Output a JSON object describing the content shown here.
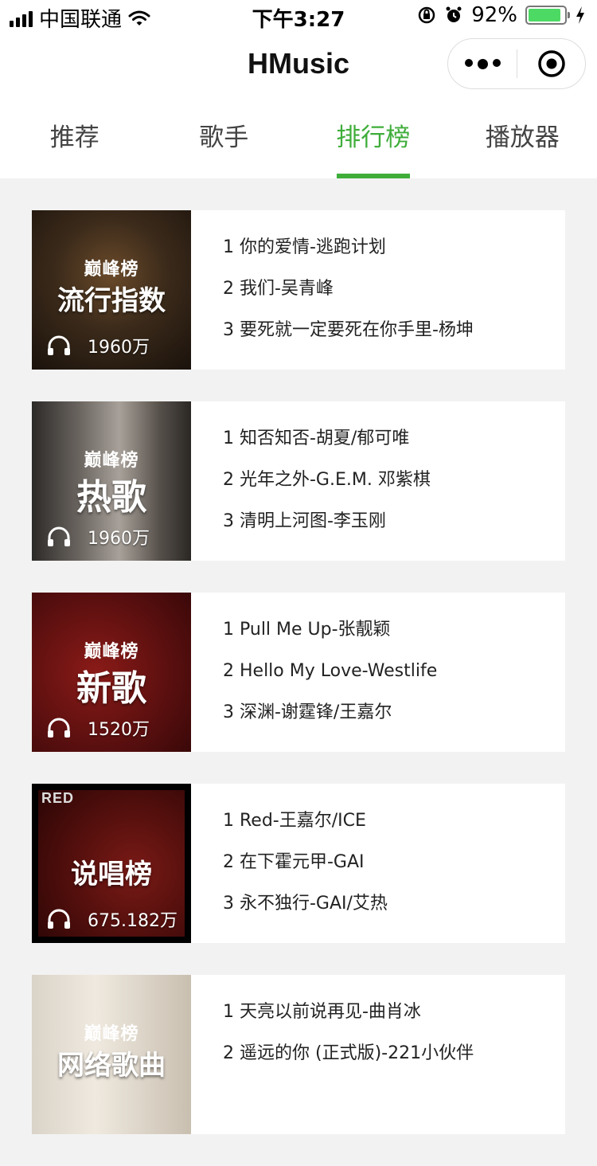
{
  "status_bar": {
    "carrier": "中国联通",
    "time": "下午3:27",
    "battery": "92%",
    "battery_level": 0.92
  },
  "nav": {
    "title": "HMusic"
  },
  "tabs": [
    {
      "label": "推荐",
      "active": false
    },
    {
      "label": "歌手",
      "active": false
    },
    {
      "label": "排行榜",
      "active": true
    },
    {
      "label": "播放器",
      "active": false
    }
  ],
  "accent_color": "#3fad3a",
  "charts": [
    {
      "brand": "巅峰榜",
      "name": "流行指数",
      "listens": "1960万",
      "songs": [
        "1 你的爱情-逃跑计划",
        "2 我们-吴青峰",
        "3 要死就一定要死在你手里-杨坤"
      ]
    },
    {
      "brand": "巅峰榜",
      "name": "热歌",
      "listens": "1960万",
      "songs": [
        "1 知否知否-胡夏/郁可唯",
        "2 光年之外-G.E.M. 邓紫棋",
        "3 清明上河图-李玉刚"
      ]
    },
    {
      "brand": "巅峰榜",
      "name": "新歌",
      "listens": "1520万",
      "songs": [
        "1 Pull Me Up-张靓颖",
        "2 Hello My Love-Westlife",
        "3 深渊-谢霆锋/王嘉尔"
      ]
    },
    {
      "brand": "",
      "cover_text": "RED",
      "name": "说唱榜",
      "listens": "675.182万",
      "songs": [
        "1 Red-王嘉尔/ICE",
        "2 在下霍元甲-GAI",
        "3 永不独行-GAI/艾热"
      ]
    },
    {
      "brand": "巅峰榜",
      "name": "网络歌曲",
      "listens": "",
      "songs": [
        "1 天亮以前说再见-曲肖冰",
        "2 遥远的你 (正式版)-221小伙伴",
        ""
      ]
    }
  ]
}
